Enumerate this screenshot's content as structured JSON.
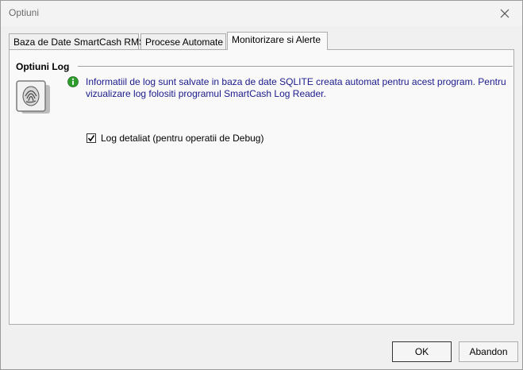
{
  "window": {
    "title": "Optiuni"
  },
  "tabs": [
    {
      "label": "Baza de Date SmartCash RMS"
    },
    {
      "label": "Procese Automate"
    },
    {
      "label": "Monitorizare si Alerte"
    }
  ],
  "section": {
    "title": "Optiuni Log",
    "info": "Informatiil de log sunt salvate in baza de date SQLITE creata automat pentru acest program. Pentru vizualizare log folositi programul SmartCash Log Reader.",
    "info_icon": "info-icon",
    "log_icon": "fingerprint-document-icon"
  },
  "options": {
    "log_detailed": {
      "label": "Log detaliat (pentru operatii de Debug)",
      "checked": true
    }
  },
  "buttons": {
    "ok": "OK",
    "cancel": "Abandon"
  },
  "colors": {
    "info_text": "#1a1a8c",
    "info_icon": "#2e9c2e"
  }
}
